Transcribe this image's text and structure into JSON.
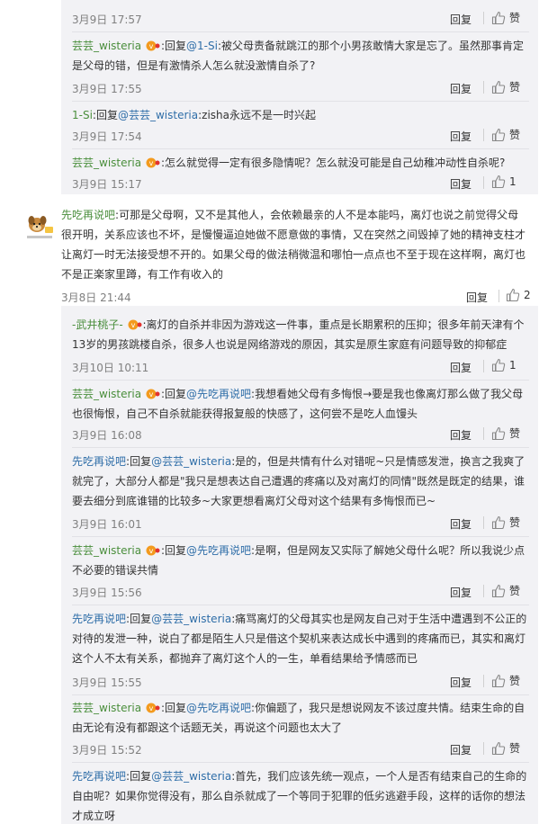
{
  "labels": {
    "reply": "回复",
    "like": "赞"
  },
  "top_comments": [
    {
      "time": "3月9日 17:57",
      "likes": "赞"
    },
    {
      "user": "芸芸_wisteria",
      "reply_word": "回复",
      "mention": "@1-Si",
      "text": "被父母责备就跳江的那个小男孩敢情大家是忘了。虽然那事肯定是父母的错，但是有激情杀人怎么就没激情自杀了?",
      "time": "3月9日 17:55",
      "likes": "赞"
    },
    {
      "user": "1-Si",
      "reply_word": "回复",
      "mention": "@芸芸_wisteria",
      "text": "zisha永远不是一时兴起",
      "time": "3月9日 17:54",
      "likes": "赞"
    },
    {
      "user": "芸芸_wisteria",
      "text": "怎么就觉得一定有很多隐情呢？怎么就没可能是自己幼稚冲动性自杀呢?",
      "time": "3月9日 15:17",
      "likes": "1"
    }
  ],
  "main_comment": {
    "user": "先吃再说吧",
    "text": "可那是父母啊，又不是其他人，会依赖最亲的人不是本能吗，离灯也说之前觉得父母很开明，关系应该也不坏，是慢慢逼迫她做不愿意做的事情，又在突然之间毁掉了她的精神支柱才让离灯一时无法接受想不开的。如果父母的做法稍微温和哪怕一点点也不至于现在这样啊，离灯也不是正楽家里蹲，有工作有收入的",
    "time": "3月8日 21:44",
    "likes": "2"
  },
  "sub_comments": [
    {
      "user": "-武井桃子-",
      "text": "离灯的自杀并非因为游戏这一件事，重点是长期累积的压抑；很多年前天津有个13岁的男孩跳楼自杀，很多人也说是网络游戏的原因，其实是原生家庭有问题导致的抑郁症",
      "time": "3月10日 10:11",
      "likes": "1"
    },
    {
      "user": "芸芸_wisteria",
      "reply_word": "回复",
      "mention": "@先吃再说吧",
      "text": "我想看她父母有多悔恨→要是我也像离灯那么做了我父母也很悔恨，自己不自杀就能获得报复般的快感了，这何尝不是吃人血馒头",
      "time": "3月9日 16:08",
      "likes": "赞"
    },
    {
      "user": "先吃再说吧",
      "reply_word": "回复",
      "mention": "@芸芸_wisteria",
      "text": "是的，但是共情有什么对错呢~只是情感发泄，换言之我爽了就完了，大部分人都是\"我只是想表达自己遭遇的疼痛以及对离灯的同情\"既然是既定的结果，谁要去细分到底谁错的比较多~大家更想看离灯父母对这个结果有多悔恨而已~",
      "time": "3月9日 16:01",
      "likes": "赞"
    },
    {
      "user": "芸芸_wisteria",
      "reply_word": "回复",
      "mention": "@先吃再说吧",
      "text": "是啊，但是网友又实际了解她父母什么呢？所以我说少点不必要的错误共情",
      "time": "3月9日 15:56",
      "likes": "赞"
    },
    {
      "user": "先吃再说吧",
      "reply_word": "回复",
      "mention": "@芸芸_wisteria",
      "text": "痛骂离灯的父母其实也是网友自己对于生活中遭遇到不公正的对待的发泄一种，说白了都是陌生人只是借这个契机来表达成长中遇到的疼痛而已，其实和离灯这个人不太有关系，都抛弃了离灯这个人的一生，单看结果给予情感而已",
      "time": "3月9日 15:55",
      "likes": "赞"
    },
    {
      "user": "芸芸_wisteria",
      "reply_word": "回复",
      "mention": "@先吃再说吧",
      "text": "你偏题了，我只是想说网友不该过度共情。结束生命的自由无论有没有都跟这个话题无关，再说这个问题也太大了",
      "time": "3月9日 15:52",
      "likes": "赞"
    },
    {
      "user": "先吃再说吧",
      "reply_word": "回复",
      "mention": "@芸芸_wisteria",
      "text": "首先，我们应该先统一观点，一个人是否有结束自己的生命的自由呢？如果你觉得没有，那么自杀就成了一个等同于犯罪的低劣逃避手段，这样的话你的想法才成立呀",
      "time": "",
      "likes": ""
    }
  ],
  "colors": {
    "green_name": "#4a8e3c",
    "blue_link": "#2f6ea8",
    "panel_bg": "#f2f2f5",
    "meta_gray": "#808080"
  },
  "icons": [
    "thumb-up-icon",
    "vip-badge-icon",
    "avatar-dog"
  ]
}
